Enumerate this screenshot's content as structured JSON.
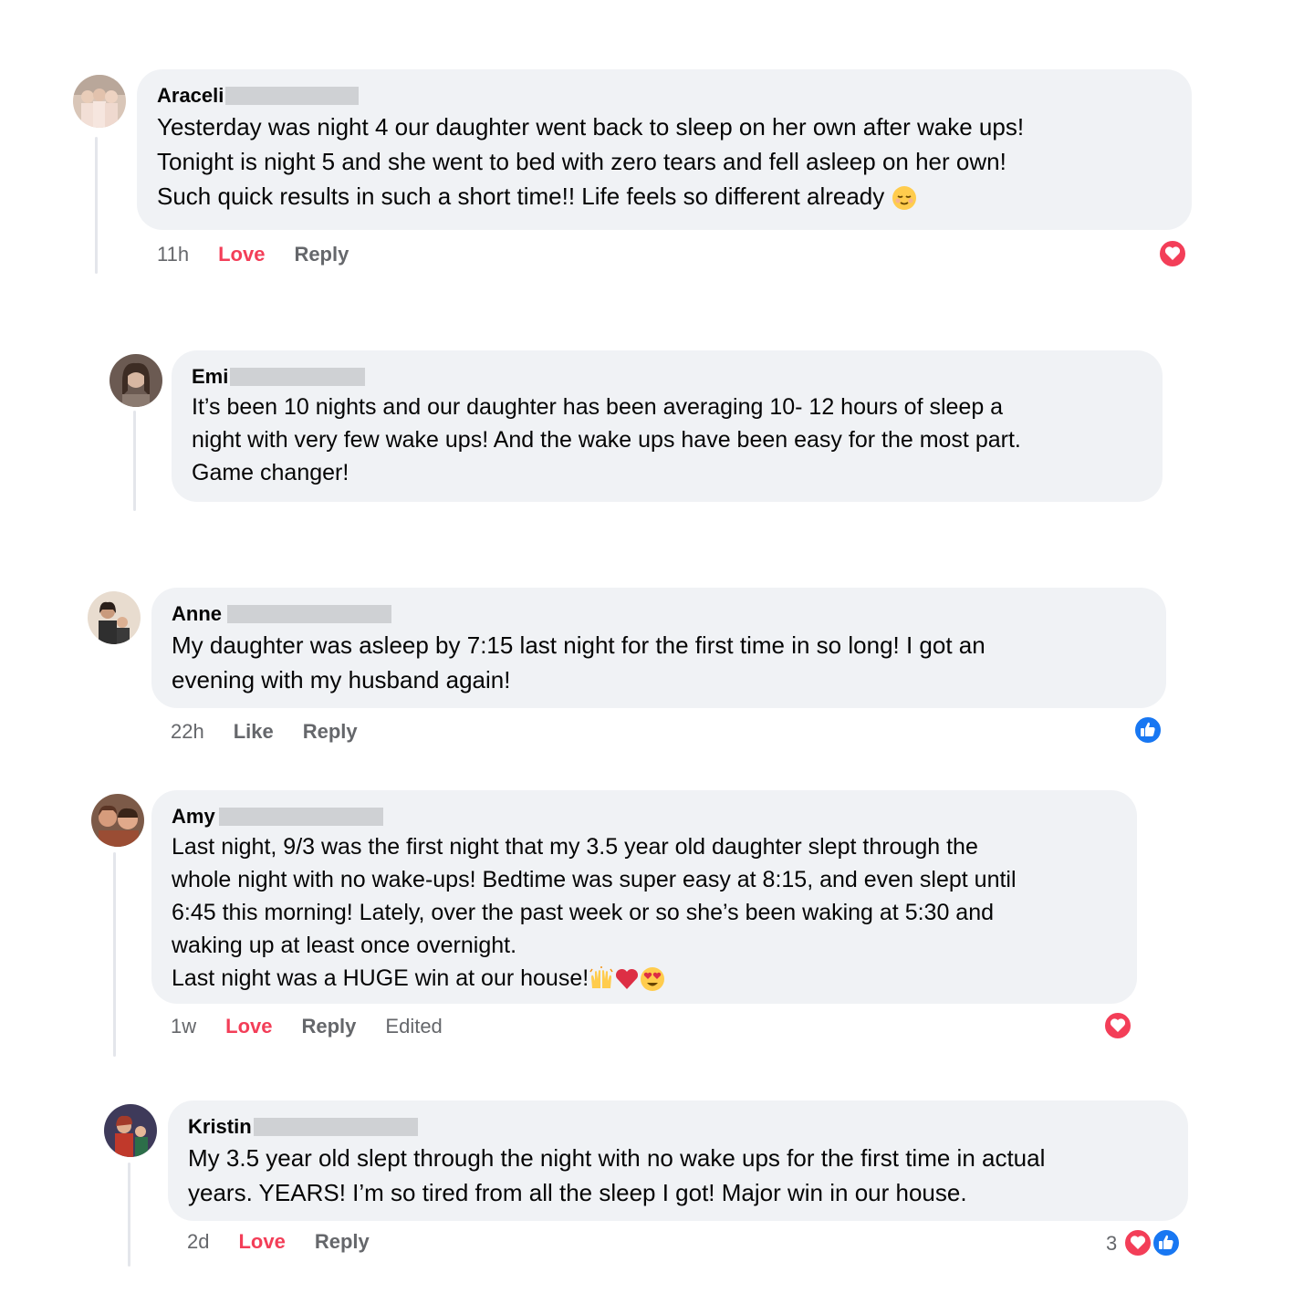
{
  "colors": {
    "bubble_bg": "#f0f2f5",
    "love_red": "#f33e58",
    "like_blue": "#1877f2",
    "meta_gray": "#65676b"
  },
  "comments": [
    {
      "name": "Araceli",
      "text": "Yesterday was night 4 our daughter went back to sleep on her own after wake ups!\nTonight is night 5 and she went to bed with zero tears and fell asleep on her own!\nSuch quick results in such a short time!! Life feels so different already",
      "trailing_emoji": "relieved-face-icon",
      "time": "11h",
      "reaction_label": "Love",
      "reply_label": "Reply",
      "reaction_icon": "love-reaction-icon"
    },
    {
      "name": "Emi",
      "text": "It’s been 10 nights and our daughter has been averaging 10- 12 hours of sleep a\nnight with very few wake ups! And the wake ups have been easy for the most part.\nGame changer!"
    },
    {
      "name": "Anne",
      "text": "My daughter was asleep by 7:15 last night for the first time in so long! I got an\nevening with my husband again!",
      "time": "22h",
      "reaction_label": "Like",
      "reply_label": "Reply",
      "reaction_icon": "like-reaction-icon"
    },
    {
      "name": "Amy",
      "text": "Last night, 9/3 was the first night that my 3.5 year old daughter slept through the\nwhole night with no wake-ups! Bedtime was super easy at 8:15, and even slept until\n6:45 this morning! Lately, over the past week or so she’s been waking at 5:30 and\nwaking up at least once overnight.\nLast night was a HUGE win at our house!",
      "trailing_emojis": [
        "raising-hands-icon",
        "red-heart-icon",
        "heart-eyes-icon"
      ],
      "time": "1w",
      "reaction_label": "Love",
      "reply_label": "Reply",
      "edited_label": "Edited",
      "reaction_icon": "love-reaction-icon"
    },
    {
      "name": "Kristin",
      "text": "My 3.5 year old slept through the night with no wake ups for the first time in actual\nyears. YEARS! I’m so tired from all the sleep I got! Major win in our house.",
      "time": "2d",
      "reaction_label": "Love",
      "reply_label": "Reply",
      "reaction_count": "3",
      "reaction_icons": [
        "love-reaction-icon",
        "like-reaction-icon"
      ]
    }
  ]
}
